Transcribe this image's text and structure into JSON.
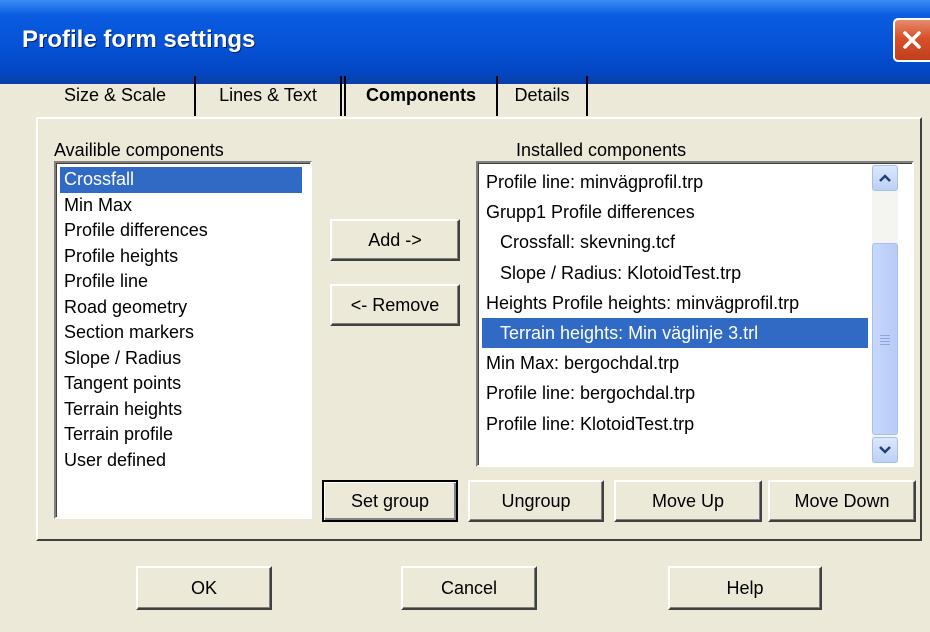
{
  "window": {
    "title": "Profile form settings"
  },
  "tabs": [
    {
      "label": "Size & Scale"
    },
    {
      "label": "Lines & Text"
    },
    {
      "label": "Components",
      "active": true
    },
    {
      "label": "Details"
    }
  ],
  "available": {
    "label": "Availible components",
    "items": [
      "Crossfall",
      "Min Max",
      "Profile differences",
      "Profile heights",
      "Profile line",
      "Road geometry",
      "Section markers",
      "Slope / Radius",
      "Tangent points",
      "Terrain heights",
      "Terrain profile",
      "User defined"
    ],
    "selected_index": 0
  },
  "installed": {
    "label": "Installed components",
    "items": [
      "Profile line: minvägprofil.trp",
      "Grupp1 Profile differences",
      "Crossfall: skevning.tcf",
      "Slope / Radius: KlotoidTest.trp",
      "Heights Profile heights: minvägprofil.trp",
      "Terrain heights: Min väglinje 3.trl",
      "Min Max: bergochdal.trp",
      "Profile line: bergochdal.trp",
      "Profile line: KlotoidTest.trp"
    ],
    "selected_index": 5
  },
  "buttons": {
    "add": "Add ->",
    "remove": "<- Remove",
    "set_group": "Set group",
    "ungroup": "Ungroup",
    "move_up": "Move Up",
    "move_down": "Move Down",
    "ok": "OK",
    "cancel": "Cancel",
    "help": "Help"
  },
  "colors": {
    "titlebar": "#0552d6",
    "selection": "#316ac5",
    "dialog_bg": "#ece9d8",
    "close": "#d8502a"
  }
}
